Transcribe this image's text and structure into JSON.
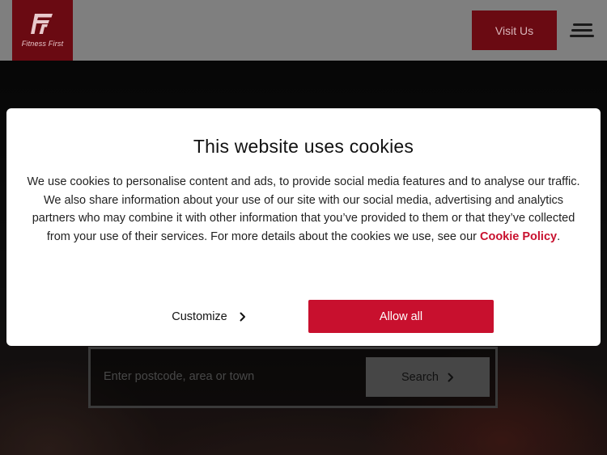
{
  "header": {
    "logo_text": "Fitness First",
    "visit_label": "Visit Us",
    "menu_icon": "hamburger-menu-icon"
  },
  "hero": {
    "search_placeholder": "Enter postcode, area or town",
    "search_label": "Search"
  },
  "cookie_dialog": {
    "title": "This website uses cookies",
    "body_text": "We use cookies to personalise content and ads, to provide social media features and to analyse our traffic. We also share information about your use of our site with our social media, advertising and analytics partners who may combine it with other information that you’ve provided to them or that they’ve collected from your use of their services. For more details about the cookies we use, see our ",
    "policy_link": "Cookie Policy",
    "period": ".",
    "customize_label": "Customize",
    "allow_label": "Allow all"
  },
  "colors": {
    "brand_red": "#c8102e",
    "header_bg": "#7f7f7f"
  }
}
